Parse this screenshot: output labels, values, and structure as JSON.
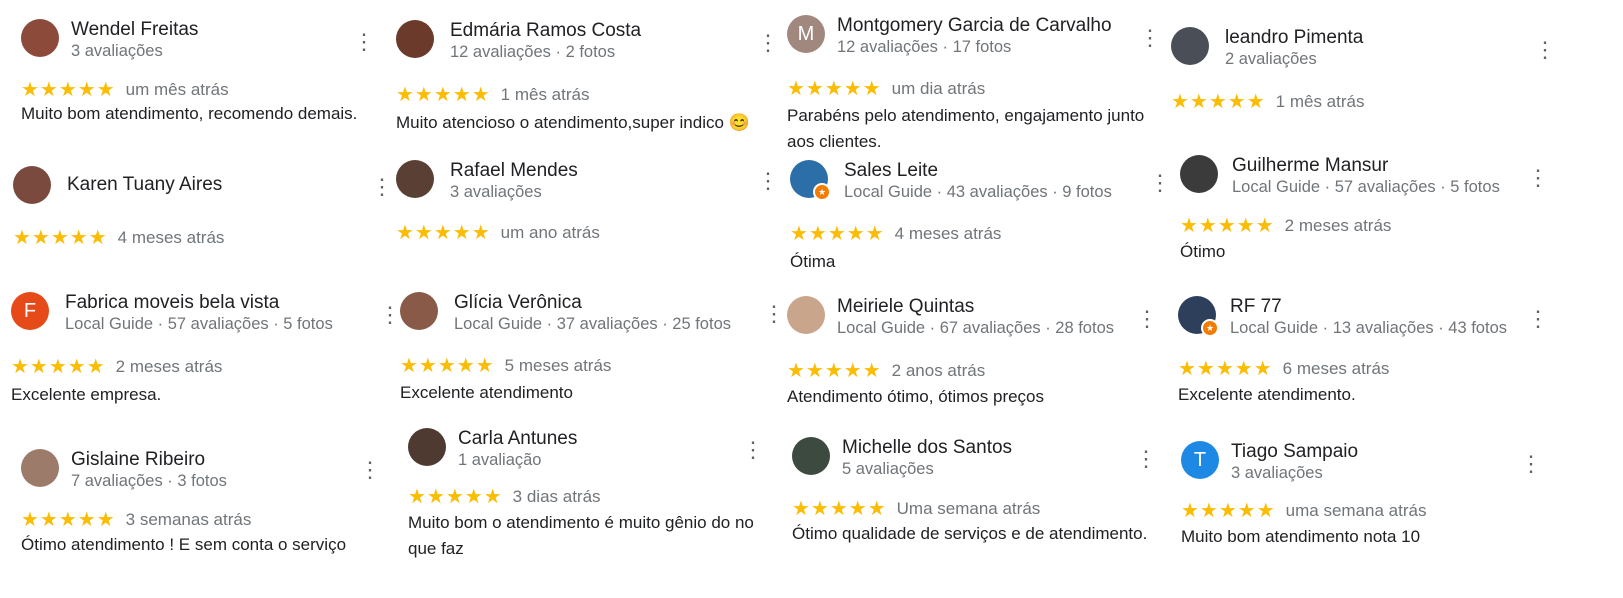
{
  "colors": {
    "star": "#fbbc04",
    "name": "#202124",
    "meta": "#70757a",
    "menu": "#5f6368",
    "local_guide_badge": "#f57c00"
  },
  "icons": {
    "menu": "more-vert-icon",
    "star": "star-icon",
    "guide_badge": "local-guide-badge-icon"
  },
  "reviews": [
    {
      "name": "Wendel Freitas",
      "meta": "3 avaliações",
      "stars": "★★★★★",
      "time": "um mês atrás",
      "text": "Muito bom atendimento, recomendo demais.",
      "avatar_initial": "",
      "avatar_color": "#8c4a3a",
      "menu": "⋮"
    },
    {
      "name": "Edmária Ramos Costa",
      "meta": "12 avaliações · 2 fotos",
      "stars": "★★★★★",
      "time": "1 mês atrás",
      "text": "Muito atencioso o atendimento,super indico 😊",
      "avatar_initial": "",
      "avatar_color": "#6b3a2a",
      "menu": "⋮"
    },
    {
      "name": "Montgomery Garcia de Carvalho",
      "meta": "12 avaliações · 17 fotos",
      "stars": "★★★★★",
      "time": "um dia atrás",
      "text": "Parabéns pelo atendimento, engajamento junto aos clientes.",
      "avatar_initial": "M",
      "avatar_color": "#a1887f",
      "menu": "⋮"
    },
    {
      "name": "leandro Pimenta",
      "meta": "2 avaliações",
      "stars": "★★★★★",
      "time": "1 mês atrás",
      "text": "",
      "avatar_initial": "",
      "avatar_color": "#4a4f57",
      "menu": "⋮"
    },
    {
      "name": "Karen Tuany Aires",
      "meta": "",
      "stars": "★★★★★",
      "time": "4 meses atrás",
      "text": "",
      "avatar_initial": "",
      "avatar_color": "#7a4a3e",
      "menu": "⋮"
    },
    {
      "name": "Rafael Mendes",
      "meta": "3 avaliações",
      "stars": "★★★★★",
      "time": "um ano atrás",
      "text": "",
      "avatar_initial": "",
      "avatar_color": "#5a4034",
      "menu": "⋮"
    },
    {
      "name": "Sales Leite",
      "meta": "Local Guide · 43 avaliações · 9 fotos",
      "stars": "★★★★★",
      "time": "4 meses atrás",
      "text": "Ótima",
      "avatar_initial": "",
      "avatar_color": "#2c6fa8",
      "menu": "⋮"
    },
    {
      "name": "Guilherme Mansur",
      "meta": "Local Guide · 57 avaliações · 5 fotos",
      "stars": "★★★★★",
      "time": "2 meses atrás",
      "text": "Ótimo",
      "avatar_initial": "",
      "avatar_color": "#3b3b3b",
      "menu": "⋮"
    },
    {
      "name": "Fabrica moveis bela vista",
      "meta": "Local Guide · 57 avaliações · 5 fotos",
      "stars": "★★★★★",
      "time": "2 meses atrás",
      "text": "Excelente empresa.",
      "avatar_initial": "F",
      "avatar_color": "#e64a19",
      "menu": "⋮"
    },
    {
      "name": "Glícia Verônica",
      "meta": "Local Guide · 37 avaliações · 25 fotos",
      "stars": "★★★★★",
      "time": "5 meses atrás",
      "text": "Excelente atendimento",
      "avatar_initial": "",
      "avatar_color": "#8a5a48",
      "menu": "⋮"
    },
    {
      "name": "Meiriele Quintas",
      "meta": "Local Guide · 67 avaliações · 28 fotos",
      "stars": "★★★★★",
      "time": "2 anos atrás",
      "text": "Atendimento ótimo, ótimos preços",
      "avatar_initial": "",
      "avatar_color": "#c9a58c",
      "menu": "⋮"
    },
    {
      "name": "RF 77",
      "meta": "Local Guide · 13 avaliações · 43 fotos",
      "stars": "★★★★★",
      "time": "6 meses atrás",
      "text": "Excelente atendimento.",
      "avatar_initial": "",
      "avatar_color": "#2e3f5c",
      "menu": "⋮"
    },
    {
      "name": "Gislaine Ribeiro",
      "meta": "7 avaliações · 3 fotos",
      "stars": "★★★★★",
      "time": "3 semanas atrás",
      "text": "Ótimo atendimento ! E sem conta o serviço",
      "avatar_initial": "",
      "avatar_color": "#9c7b6a",
      "menu": "⋮"
    },
    {
      "name": "Carla Antunes",
      "meta": "1 avaliação",
      "stars": "★★★★★",
      "time": "3 dias atrás",
      "text": "Muito bom o atendimento é muito gênio do no que faz",
      "avatar_initial": "",
      "avatar_color": "#4e3a30",
      "menu": "⋮"
    },
    {
      "name": "Michelle dos Santos",
      "meta": "5 avaliações",
      "stars": "★★★★★",
      "time": "Uma semana atrás",
      "text": "Ótimo qualidade de serviços e de atendimento.",
      "avatar_initial": "",
      "avatar_color": "#3d4a3f",
      "menu": "⋮"
    },
    {
      "name": "Tiago Sampaio",
      "meta": "3 avaliações",
      "stars": "★★★★★",
      "time": "uma semana atrás",
      "text": "Muito bom atendimento nota 10",
      "avatar_initial": "T",
      "avatar_color": "#1e88e5",
      "menu": "⋮"
    }
  ]
}
